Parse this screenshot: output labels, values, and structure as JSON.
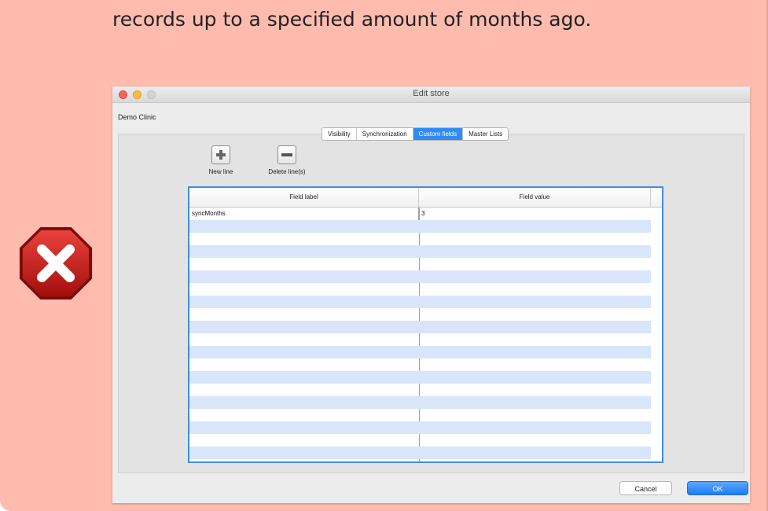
{
  "note": {
    "text": "records up to a specified amount of months ago.",
    "icon": "error-x-octagon-icon"
  },
  "window": {
    "title": "Edit store",
    "store_name": "Demo Clinic",
    "tabs": [
      {
        "label": "Visibility",
        "active": false
      },
      {
        "label": "Synchronization",
        "active": false
      },
      {
        "label": "Custom fields",
        "active": true
      },
      {
        "label": "Master Lists",
        "active": false
      }
    ],
    "toolbar": {
      "new_line_label": "New line",
      "delete_lines_label": "Delete line(s)"
    },
    "table": {
      "columns": [
        "Field label",
        "Field value"
      ],
      "rows": [
        {
          "label": "syncMonths",
          "value": "3"
        }
      ]
    },
    "buttons": {
      "cancel": "Cancel",
      "ok": "OK"
    }
  }
}
